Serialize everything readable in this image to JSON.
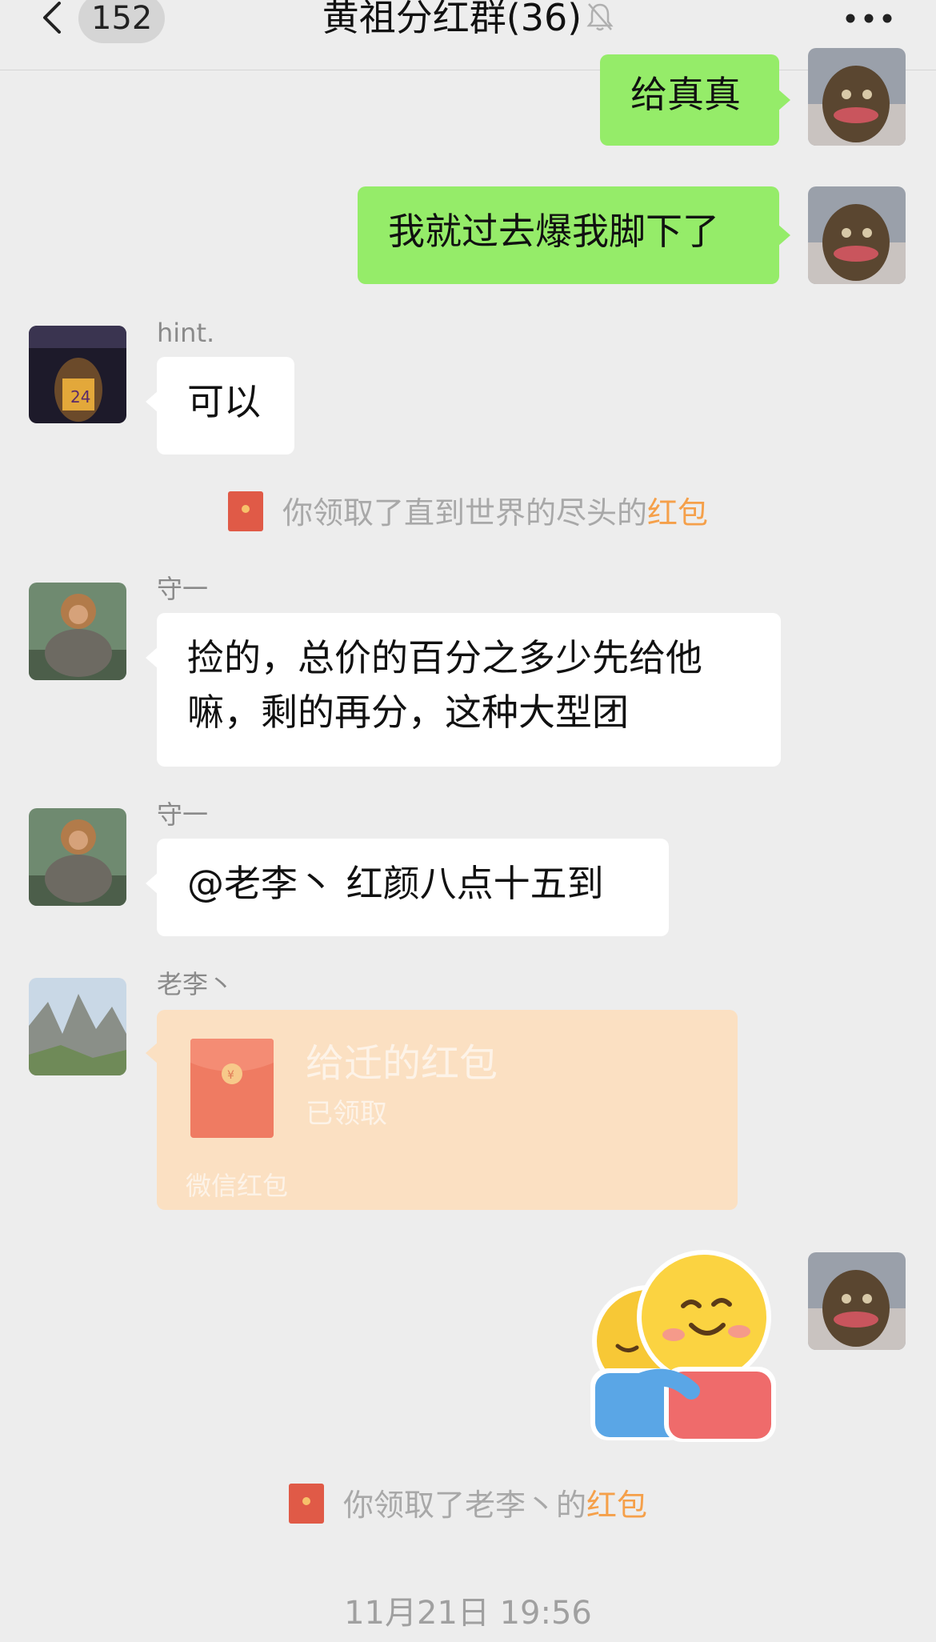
{
  "header": {
    "unread_count": "152",
    "title": "黄祖分红群(36)"
  },
  "messages": [
    {
      "id": "m1",
      "side": "right",
      "text": "给真真"
    },
    {
      "id": "m2",
      "side": "right",
      "text": "我就过去爆我脚下了"
    },
    {
      "id": "m3",
      "side": "left",
      "sender": "hint.",
      "text": "可以"
    },
    {
      "id": "m4",
      "side": "left",
      "sender": "守一",
      "lines": [
        "捡的，总价的百分之多少先给他",
        "嘛，剩的再分，这种大型团"
      ]
    },
    {
      "id": "m5",
      "side": "left",
      "sender": "守一",
      "text": "@老李丶 红颜八点十五到"
    },
    {
      "id": "m6",
      "side": "left",
      "sender": "老李丶"
    },
    {
      "id": "m7",
      "side": "right",
      "sticker": "hug-sticker"
    }
  ],
  "notices": [
    {
      "prefix": "你领取了直到世界的尽头的",
      "link": "红包"
    },
    {
      "prefix": "你领取了老李丶的",
      "link": "红包"
    }
  ],
  "red_packet": {
    "title": "给迁的红包",
    "status": "已领取",
    "footer": "微信红包"
  },
  "timestamp": "11月21日 19:56",
  "colors": {
    "background": "#ededed",
    "green_bubble": "#95ec69",
    "white_bubble": "#ffffff",
    "red_packet_card": "#fbe0c2",
    "red_packet_link": "#f5a04a"
  }
}
